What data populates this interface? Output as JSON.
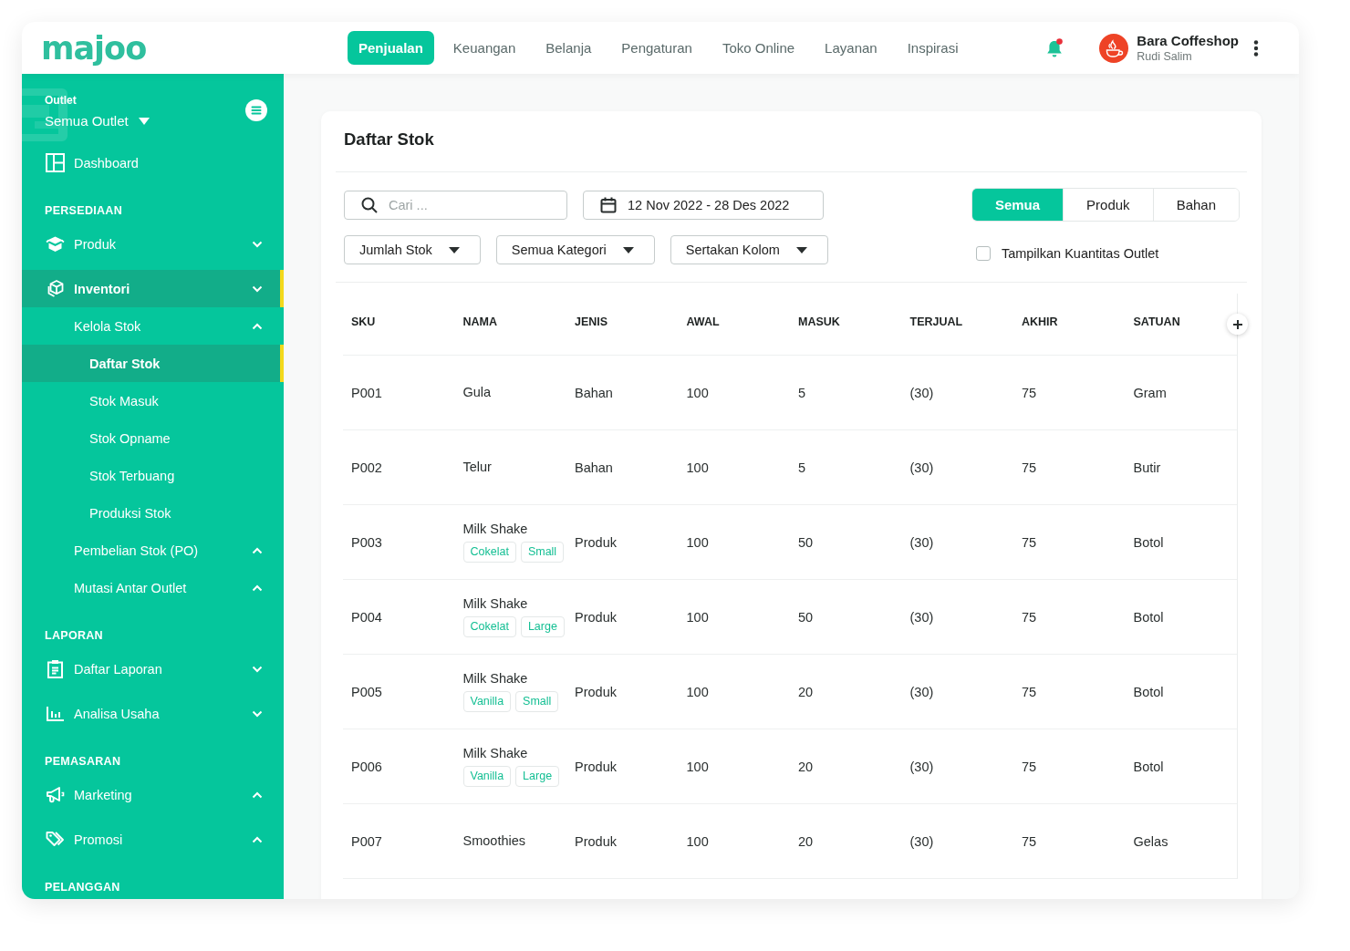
{
  "logo": "majoo",
  "top_nav": [
    {
      "label": "Penjualan",
      "selected": true
    },
    {
      "label": "Keuangan",
      "selected": false
    },
    {
      "label": "Belanja",
      "selected": false
    },
    {
      "label": "Pengaturan",
      "selected": false
    },
    {
      "label": "Toko Online",
      "selected": false
    },
    {
      "label": "Layanan",
      "selected": false
    },
    {
      "label": "Inspirasi",
      "selected": false
    }
  ],
  "notifications": {
    "unread": true
  },
  "account": {
    "name": "Bara Coffeshop",
    "user": "Rudi Salim"
  },
  "sidebar": {
    "outlet": {
      "label": "Outlet",
      "value": "Semua Outlet"
    },
    "sections": [
      {
        "items": [
          {
            "label": "Dashboard",
            "selected": false
          }
        ]
      },
      {
        "heading": "PERSEDIAAN",
        "items": [
          {
            "label": "Produk",
            "selected": false,
            "expanded": false
          },
          {
            "label": "Inventori",
            "selected": true,
            "expanded": false,
            "children": [
              {
                "label": "Kelola Stok",
                "selected": false,
                "expanded": true,
                "children": [
                  {
                    "label": "Daftar Stok",
                    "selected": true
                  },
                  {
                    "label": "Stok Masuk",
                    "selected": false
                  },
                  {
                    "label": "Stok Opname",
                    "selected": false
                  },
                  {
                    "label": "Stok Terbuang",
                    "selected": false
                  },
                  {
                    "label": "Produksi Stok",
                    "selected": false
                  }
                ]
              },
              {
                "label": "Pembelian Stok (PO)",
                "selected": false,
                "expanded": true
              },
              {
                "label": "Mutasi Antar Outlet",
                "selected": false,
                "expanded": true
              }
            ]
          }
        ]
      },
      {
        "heading": "LAPORAN",
        "items": [
          {
            "label": "Daftar Laporan",
            "selected": false,
            "expanded": false
          },
          {
            "label": "Analisa Usaha",
            "selected": false,
            "expanded": false
          }
        ]
      },
      {
        "heading": "PEMASARAN",
        "items": [
          {
            "label": "Marketing",
            "selected": false,
            "expanded": true
          },
          {
            "label": "Promosi",
            "selected": false,
            "expanded": true
          }
        ]
      },
      {
        "heading": "PELANGGAN"
      }
    ]
  },
  "page": {
    "title": "Daftar Stok"
  },
  "filters": {
    "search": {
      "placeholder": "Cari ..."
    },
    "date_range": "12 Nov 2022 - 28 Des 2022",
    "dropdowns": [
      "Jumlah Stok",
      "Semua Kategori",
      "Sertakan Kolom"
    ],
    "type_tabs": [
      {
        "label": "Semua",
        "selected": true
      },
      {
        "label": "Produk",
        "selected": false
      },
      {
        "label": "Bahan",
        "selected": false
      }
    ],
    "outlet_quantity": {
      "label": "Tampilkan Kuantitas Outlet",
      "checked": false
    }
  },
  "table": {
    "columns": [
      "SKU",
      "NAMA",
      "JENIS",
      "AWAL",
      "MASUK",
      "TERJUAL",
      "AKHIR",
      "SATUAN"
    ],
    "rows": [
      {
        "sku": "P001",
        "name": "Gula",
        "type": "Bahan",
        "start": "100",
        "incoming": "5",
        "sold": "(30)",
        "end": "75",
        "unit": "Gram"
      },
      {
        "sku": "P002",
        "name": "Telur",
        "type": "Bahan",
        "start": "100",
        "incoming": "5",
        "sold": "(30)",
        "end": "75",
        "unit": "Butir"
      },
      {
        "sku": "P003",
        "name": "Milk Shake",
        "tags": [
          "Cokelat",
          "Small"
        ],
        "type": "Produk",
        "start": "100",
        "incoming": "50",
        "sold": "(30)",
        "end": "75",
        "unit": "Botol"
      },
      {
        "sku": "P004",
        "name": "Milk Shake",
        "tags": [
          "Cokelat",
          "Large"
        ],
        "type": "Produk",
        "start": "100",
        "incoming": "50",
        "sold": "(30)",
        "end": "75",
        "unit": "Botol"
      },
      {
        "sku": "P005",
        "name": "Milk Shake",
        "tags": [
          "Vanilla",
          "Small"
        ],
        "type": "Produk",
        "start": "100",
        "incoming": "20",
        "sold": "(30)",
        "end": "75",
        "unit": "Botol"
      },
      {
        "sku": "P006",
        "name": "Milk Shake",
        "tags": [
          "Vanilla",
          "Large"
        ],
        "type": "Produk",
        "start": "100",
        "incoming": "20",
        "sold": "(30)",
        "end": "75",
        "unit": "Botol"
      },
      {
        "sku": "P007",
        "name": "Smoothies",
        "type": "Produk",
        "start": "100",
        "incoming": "20",
        "sold": "(30)",
        "end": "75",
        "unit": "Gelas"
      }
    ]
  }
}
